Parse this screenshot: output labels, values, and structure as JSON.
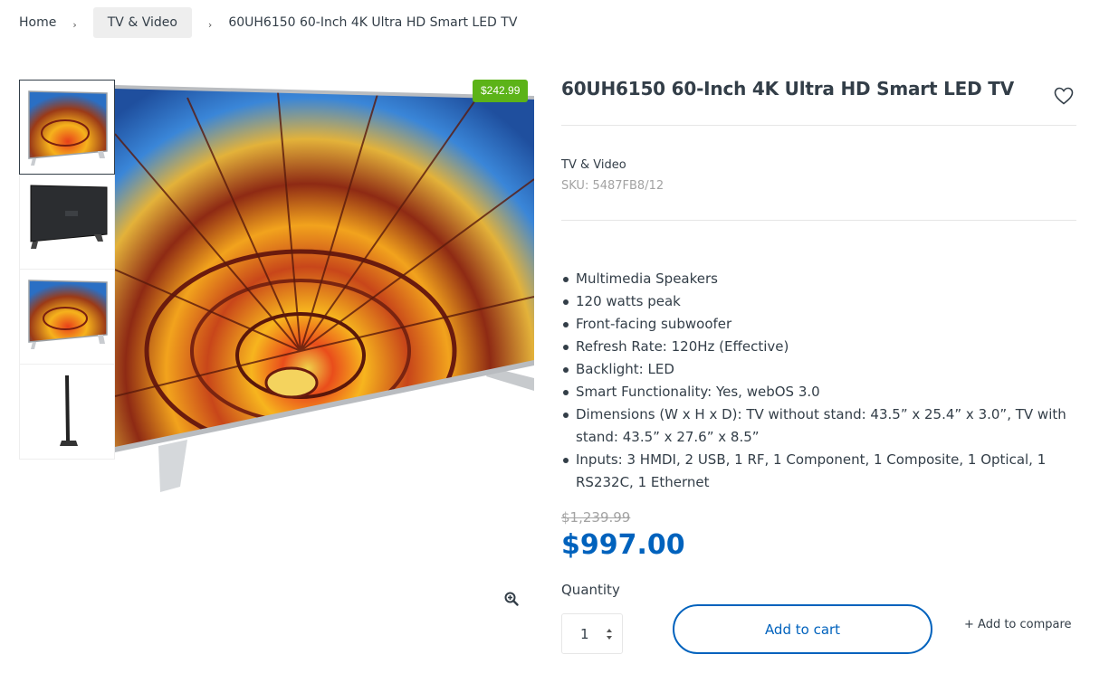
{
  "breadcrumb": {
    "home": "Home",
    "category": "TV & Video",
    "current": "60UH6150 60-Inch 4K Ultra HD Smart LED TV",
    "separator": "›"
  },
  "product": {
    "title": "60UH6150 60-Inch 4K Ultra HD Smart LED TV",
    "category": "TV & Video",
    "sku": "SKU: 5487FB8/12",
    "sale_badge": "$242.99",
    "price_old": "$1,239.99",
    "price_new": "$997.00",
    "features": [
      "Multimedia Speakers",
      "120 watts peak",
      "Front-facing subwoofer",
      "Refresh Rate: 120Hz (Effective)",
      "Backlight: LED",
      "Smart Functionality: Yes, webOS 3.0",
      "Dimensions (W x H x D): TV without stand: 43.5” x 25.4” x 3.0”, TV with stand: 43.5” x 27.6” x 8.5”",
      "Inputs: 3 HMDI, 2 USB, 1 RF, 1 Component, 1 Composite, 1 Optical, 1 RS232C, 1 Ethernet"
    ]
  },
  "purchase": {
    "quantity_label": "Quantity",
    "quantity_value": "1",
    "add_to_cart": "Add to cart",
    "add_to_compare": "+ Add to compare"
  },
  "icons": {
    "wishlist": "heart-icon",
    "zoom": "zoom-in-icon",
    "quantity_spinner": "spinner-arrows-icon"
  },
  "colors": {
    "accent_blue": "#0062bd",
    "sale_green": "#5cb318",
    "text": "#333e48",
    "muted": "#a3a3a3"
  }
}
